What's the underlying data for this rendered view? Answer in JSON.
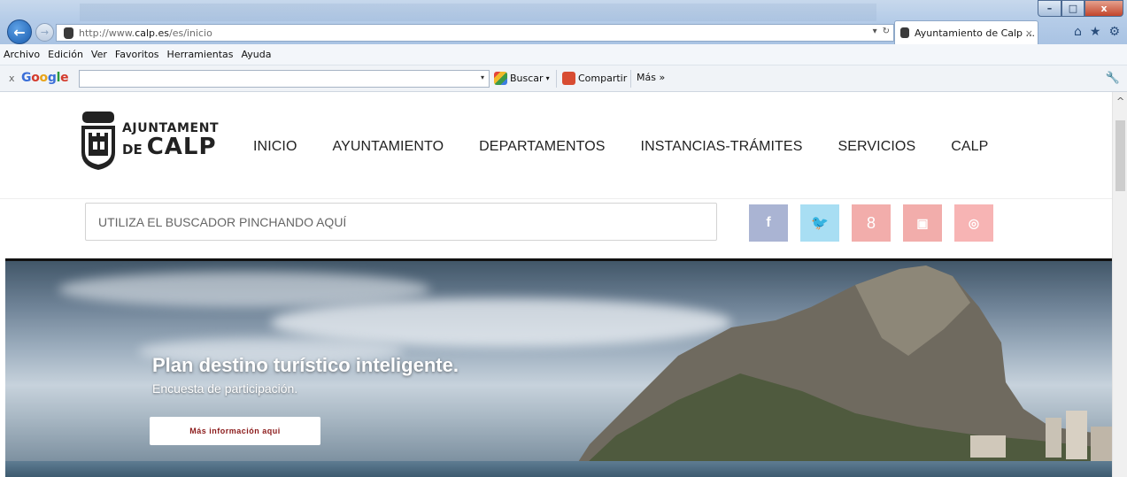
{
  "browser": {
    "url_prefix": "http://www.",
    "url_host": "calp.es",
    "url_path": "/es/inicio",
    "tab_title": "Ayuntamiento de Calp ...",
    "tab_close": "×",
    "refresh_icon": "↻",
    "dropdown_icon": "▾",
    "back_icon": "←",
    "forward_icon": "→",
    "home_icon": "⌂",
    "favorites_icon": "★",
    "tools_icon": "⚙",
    "win_min": "–",
    "win_max": "□",
    "win_close": "x"
  },
  "menu": [
    "Archivo",
    "Edición",
    "Ver",
    "Favoritos",
    "Herramientas",
    "Ayuda"
  ],
  "google_bar": {
    "close": "x",
    "logo": "Google",
    "search_label": "Buscar",
    "share_label": "Compartir",
    "more_label": "Más »",
    "dropdown": "▾"
  },
  "site": {
    "logo_line1": "AJUNTAMENT",
    "logo_de": "DE",
    "logo_calp": "CALP",
    "nav": [
      "INICIO",
      "AYUNTAMIENTO",
      "DEPARTAMENTOS",
      "INSTANCIAS-TRÁMITES",
      "SERVICIOS",
      "CALP"
    ],
    "search_placeholder": "UTILIZA EL BUSCADOR PINCHANDO AQUÍ",
    "social": [
      {
        "name": "facebook",
        "glyph": "f",
        "color": "#aab4d3"
      },
      {
        "name": "twitter",
        "glyph": "🐦",
        "color": "#a8def3"
      },
      {
        "name": "google-plus",
        "glyph": "8",
        "color": "#f2adab"
      },
      {
        "name": "youtube",
        "glyph": "▣",
        "color": "#f2adab"
      },
      {
        "name": "instagram",
        "glyph": "◎",
        "color": "#f7b4b4"
      }
    ],
    "hero": {
      "title": "Plan destino turístico inteligente.",
      "subtitle": "Encuesta de participación.",
      "button": "Más información aqui"
    }
  },
  "scroll_up": "^"
}
